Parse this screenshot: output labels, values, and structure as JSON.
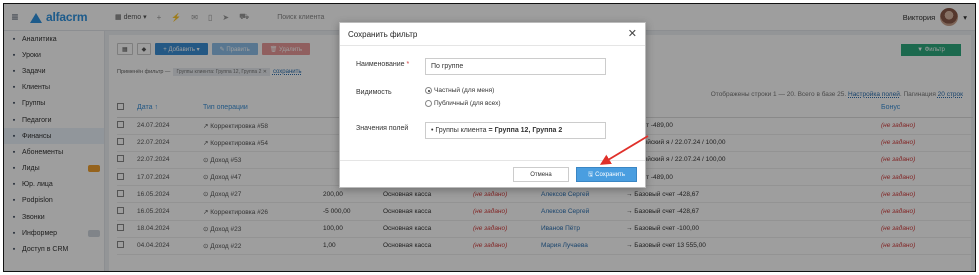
{
  "topbar": {
    "logo": "alfacrm",
    "branch": "demo",
    "search_placeholder": "Поиск клиента",
    "user_name": "Виктория"
  },
  "sidebar": {
    "items": [
      {
        "label": "Аналитика",
        "icon": "chart-icon"
      },
      {
        "label": "Уроки",
        "icon": "lessons-icon"
      },
      {
        "label": "Задачи",
        "icon": "tasks-icon"
      },
      {
        "label": "Клиенты",
        "icon": "user-icon"
      },
      {
        "label": "Группы",
        "icon": "groups-icon"
      },
      {
        "label": "Педагоги",
        "icon": "teacher-icon"
      },
      {
        "label": "Финансы",
        "icon": "finance-icon",
        "active": true
      },
      {
        "label": "Абонементы",
        "icon": "tag-icon"
      },
      {
        "label": "Лиды",
        "icon": "leads-icon",
        "badge_color": "#f0a030"
      },
      {
        "label": "Юр. лица",
        "icon": "legal-icon"
      },
      {
        "label": "Podpislon",
        "icon": "podpislon-icon"
      },
      {
        "label": "Звонки",
        "icon": "phone-icon"
      },
      {
        "label": "Информер",
        "icon": "informer-icon",
        "badge_color": "#cfd6de"
      },
      {
        "label": "Доступ в CRM",
        "icon": "lock-icon"
      }
    ]
  },
  "toolbar": {
    "add_label": "+ Добавить ▾",
    "edit_label": "✎ Править",
    "delete_label": "🗑 Удалить",
    "filter_label": "▼ Фильтр"
  },
  "applied_filter": {
    "prefix": "Применён фильтр —",
    "chip": "Группы клиента: Группа 12, Группа 2 ✕",
    "save_link": "сохранить"
  },
  "grid_info": {
    "text": "Отображены строки 1 — 20. Всего в базе 25.",
    "settings_link": "Настройка полей",
    "pagination_label": "Пагинация",
    "pagination_value": "20 строк"
  },
  "table": {
    "headers": {
      "date": "Дата ↑",
      "operation": "Тип операции",
      "bonus": "Бонус"
    },
    "rows": [
      {
        "date": "24.07.2024",
        "op": "↗ Корректировка #58",
        "amount": "",
        "cash": "",
        "flag": "",
        "client": "",
        "desc": "ый счет -489,00",
        "bonus": "(не задано)"
      },
      {
        "date": "22.07.2024",
        "op": "↗ Корректировка #54",
        "amount": "",
        "cash": "",
        "flag": "",
        "client": "",
        "desc": "/ Английский я / 22.07.24 / 100,00",
        "bonus": "(не задано)"
      },
      {
        "date": "22.07.2024",
        "op": "⊙ Доход #53",
        "amount": "",
        "cash": "",
        "flag": "",
        "client": "",
        "desc": "/ Английский я / 22.07.24 / 100,00",
        "bonus": "(не задано)"
      },
      {
        "date": "17.07.2024",
        "op": "⊙ Доход #47",
        "amount": "",
        "cash": "",
        "flag": "",
        "client": "",
        "desc": "ый счет -489,00",
        "bonus": "(не задано)"
      },
      {
        "date": "16.05.2024",
        "op": "⊙ Доход #27",
        "amount": "200,00",
        "cash": "Основная касса",
        "flag": "(не задано)",
        "client": "Алексов Сергей",
        "desc": "→ Базовый счет -428,67",
        "bonus": "(не задано)"
      },
      {
        "date": "16.05.2024",
        "op": "↗ Корректировка #26",
        "amount": "-5 000,00",
        "cash": "Основная касса",
        "flag": "(не задано)",
        "client": "Алексов Сергей",
        "desc": "→ Базовый счет -428,67",
        "bonus": "(не задано)"
      },
      {
        "date": "18.04.2024",
        "op": "⊙ Доход #23",
        "amount": "100,00",
        "cash": "Основная касса",
        "flag": "(не задано)",
        "client": "Иванов Пётр",
        "desc": "→ Базовый счет -100,00",
        "bonus": "(не задано)"
      },
      {
        "date": "04.04.2024",
        "op": "⊙ Доход #22",
        "amount": "1,00",
        "cash": "Основная касса",
        "flag": "(не задано)",
        "client": "Мария Лучаева",
        "desc": "→ Базовый счет 13 555,00",
        "bonus": "(не задано)"
      }
    ]
  },
  "modal": {
    "title": "Сохранить фильтр",
    "name_label": "Наименование",
    "name_required": "*",
    "name_value": "По группе",
    "visibility_label": "Видимость",
    "private_option": "Частный (для меня)",
    "public_option": "Публичный (для всех)",
    "values_label": "Значения полей",
    "values_prefix": "• Группы клиента",
    "values_text": "= Группа 12, Группа 2",
    "cancel_label": "Отмена",
    "save_label": "Сохранить"
  },
  "colors": {
    "accent": "#3b8fd6",
    "arrow": "#e0302a",
    "filter_green": "#2eaa7f"
  }
}
